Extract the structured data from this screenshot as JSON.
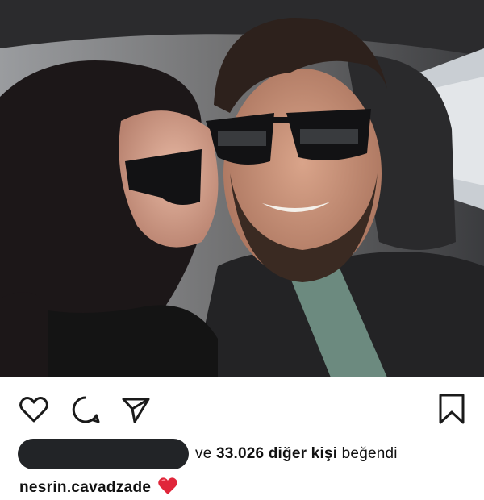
{
  "post": {
    "photo_alt": "",
    "actions": {
      "like_icon": "heart-outline-icon",
      "comment_icon": "comment-bubble-icon",
      "share_icon": "paper-plane-icon",
      "save_icon": "bookmark-outline-icon"
    },
    "likes": {
      "prefix": "ve",
      "count": "33.026 diğer kişi",
      "suffix": "beğendi"
    },
    "caption": {
      "username": "nesrin.cavadzade",
      "emoji": "red-heart-icon",
      "emoji_color": "#e0263a"
    }
  },
  "colors": {
    "icon": "#1a1a1a",
    "text": "#111111",
    "redaction": "#222427"
  }
}
